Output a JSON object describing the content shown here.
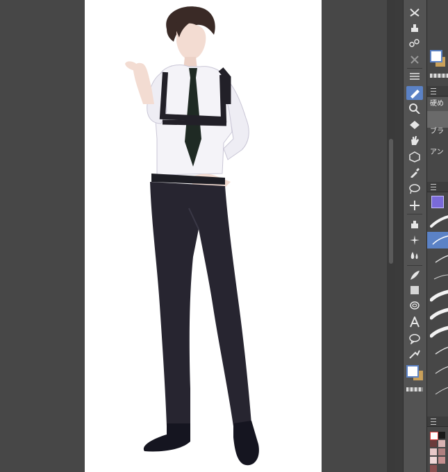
{
  "workspace": {
    "background": "#474747"
  },
  "canvas": {
    "background": "#ffffff",
    "subject": "standing-character-illustration"
  },
  "toolbar": {
    "tools": [
      {
        "name": "sub-tool-airbrush-icon"
      },
      {
        "name": "sub-tool-figure-icon"
      },
      {
        "name": "deco-icon"
      },
      {
        "name": "blend-icon"
      },
      {
        "name": "menu-lines-icon"
      },
      {
        "name": "pen-icon",
        "active": true
      },
      {
        "name": "zoom-icon"
      },
      {
        "name": "fill-icon"
      },
      {
        "name": "hand-icon"
      },
      {
        "name": "object-icon"
      },
      {
        "name": "eyedropper-icon"
      },
      {
        "name": "lasso-icon"
      },
      {
        "name": "move-icon"
      },
      {
        "name": "airbrush-icon"
      },
      {
        "name": "sparkle-icon"
      },
      {
        "name": "water-drops-icon"
      },
      {
        "name": "feather-icon"
      },
      {
        "name": "gradient-icon"
      },
      {
        "name": "spiral-icon"
      },
      {
        "name": "text-icon"
      },
      {
        "name": "speech-balloon-icon"
      },
      {
        "name": "ruler-icon"
      }
    ],
    "main_color": "#ffffff",
    "sub_color": "#c9a05a"
  },
  "panel": {
    "brush_group_label": "硬め",
    "label_a": "ブラ",
    "label_b": "アン",
    "accent": "#5b82c6",
    "palette": [
      "#ffffff",
      "#1a1a1a",
      "#6b3b3b",
      "#d9b3b3",
      "#e8c9c9",
      "#b08080",
      "#f0d9d9",
      "#c48f8f",
      "#8a5050"
    ]
  }
}
